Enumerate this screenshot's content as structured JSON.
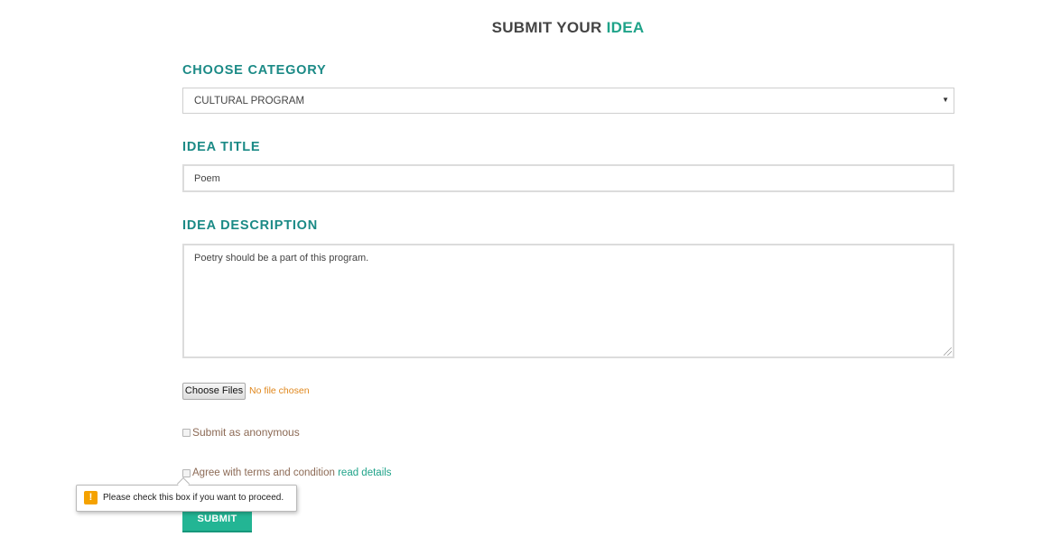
{
  "header": {
    "title_main": "SUBMIT YOUR",
    "title_accent": "IDEA"
  },
  "category": {
    "label": "CHOOSE CATEGORY",
    "selected": "CULTURAL PROGRAM"
  },
  "idea_title": {
    "label": "IDEA TITLE",
    "value": "Poem"
  },
  "idea_description": {
    "label": "IDEA DESCRIPTION",
    "value": "Poetry should be a part of this program."
  },
  "file_upload": {
    "button_label": "Choose Files",
    "status": "No file chosen"
  },
  "anonymous": {
    "label": "Submit as anonymous",
    "checked": false
  },
  "terms": {
    "label": "Agree with terms and condition",
    "link_text": "read details",
    "checked": false
  },
  "submit_label": "SUBMIT",
  "validation_tooltip": {
    "icon": "!",
    "message": "Please check this box if you want to proceed."
  },
  "colors": {
    "accent": "#1fa389",
    "heading": "#1b8a86",
    "button": "#23b594",
    "warning": "#f5a200",
    "file_status": "#e0871c"
  }
}
